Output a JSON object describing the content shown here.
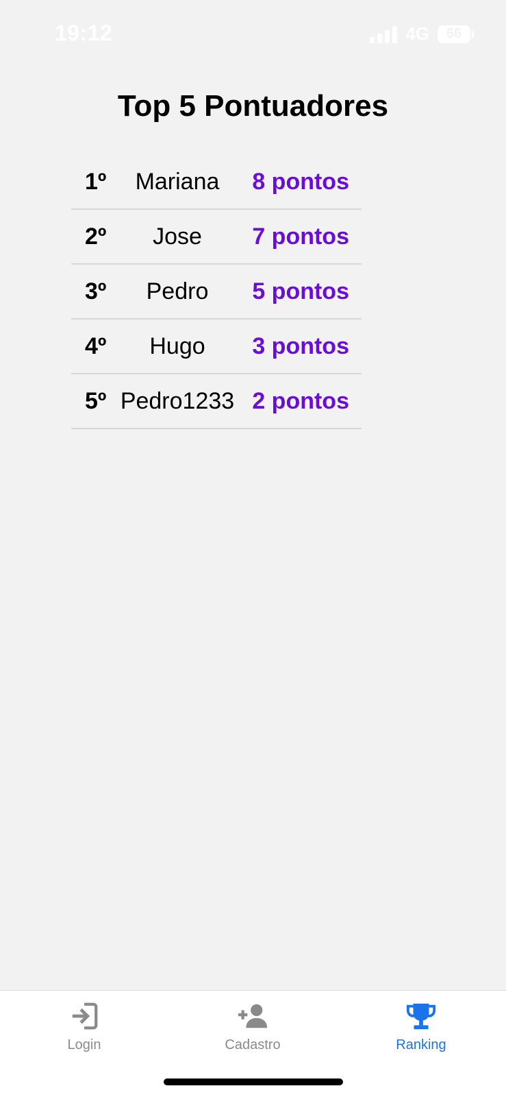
{
  "status_bar": {
    "time": "19:12",
    "network": "4G",
    "battery": "66"
  },
  "page": {
    "title": "Top 5 Pontuadores"
  },
  "ranking": [
    {
      "position": "1º",
      "name": "Mariana",
      "points": "8 pontos"
    },
    {
      "position": "2º",
      "name": "Jose",
      "points": "7 pontos"
    },
    {
      "position": "3º",
      "name": "Pedro",
      "points": "5 pontos"
    },
    {
      "position": "4º",
      "name": "Hugo",
      "points": "3 pontos"
    },
    {
      "position": "5º",
      "name": "Pedro1233",
      "points": "2 pontos"
    }
  ],
  "tab_bar": {
    "tabs": [
      {
        "label": "Login",
        "icon": "login-icon",
        "active": false
      },
      {
        "label": "Cadastro",
        "icon": "add-user-icon",
        "active": false
      },
      {
        "label": "Ranking",
        "icon": "trophy-icon",
        "active": true
      }
    ]
  },
  "colors": {
    "points": "#6a0dd6",
    "active_tab": "#1a73e8",
    "inactive_tab": "#8a8a8a",
    "background": "#f2f2f2"
  }
}
